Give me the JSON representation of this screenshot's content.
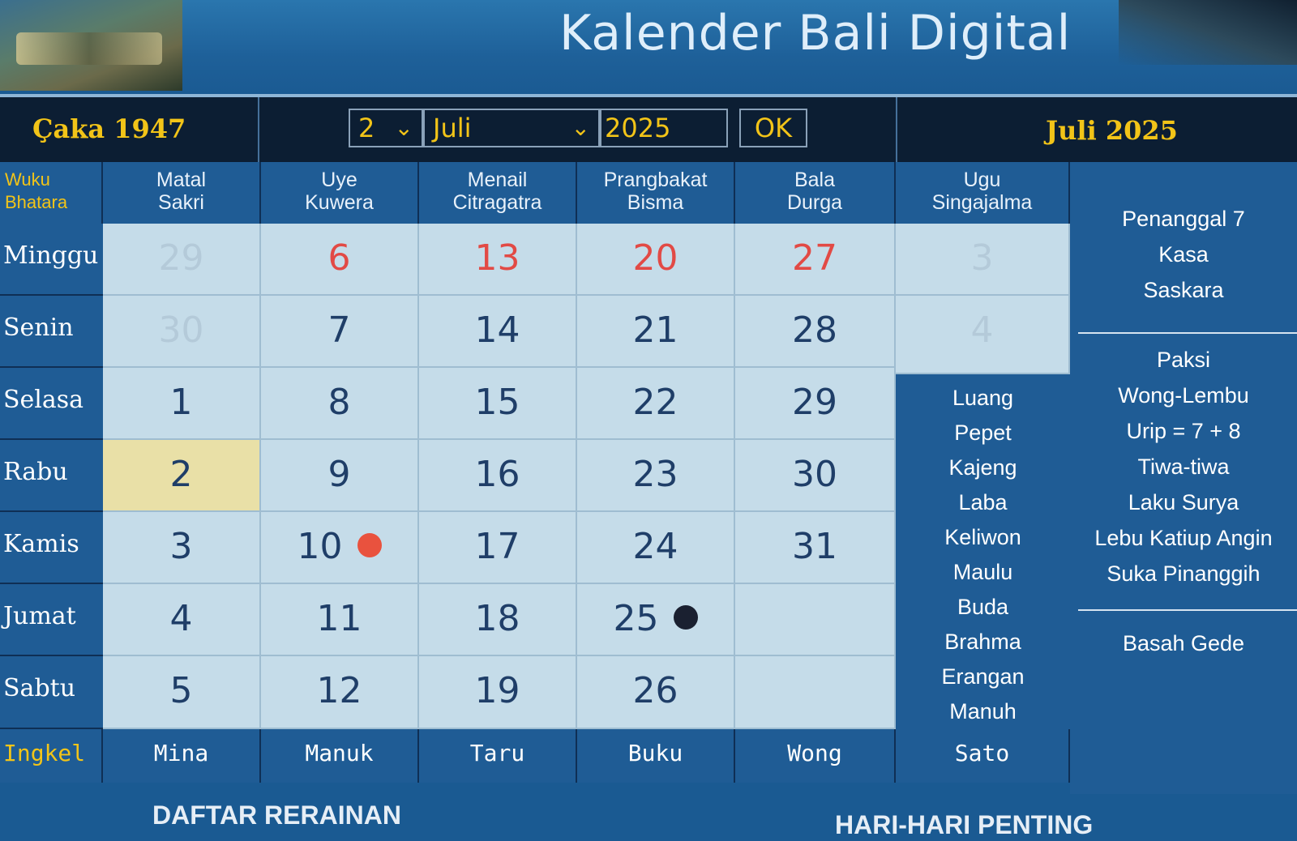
{
  "app": {
    "title": "Kalender Bali Digital"
  },
  "topbar": {
    "caka": "Çaka 1947",
    "day_select": "2",
    "month_select": "Juli",
    "year_input": "2025",
    "ok_label": "OK",
    "current_month": "Juli 2025"
  },
  "grid": {
    "corner_label": [
      "Wuku",
      "Bhatara"
    ],
    "columns": [
      {
        "line1": "Matal",
        "line2": "Sakri"
      },
      {
        "line1": "Uye",
        "line2": "Kuwera"
      },
      {
        "line1": "Menail",
        "line2": "Citragatra"
      },
      {
        "line1": "Prangbakat",
        "line2": "Bisma"
      },
      {
        "line1": "Bala",
        "line2": "Durga"
      },
      {
        "line1": "Ugu",
        "line2": "Singajalma"
      }
    ],
    "rows": [
      "Minggu",
      "Senin",
      "Selasa",
      "Rabu",
      "Kamis",
      "Jumat",
      "Sabtu"
    ],
    "cells": [
      [
        "29",
        "6",
        "13",
        "20",
        "27",
        "3"
      ],
      [
        "30",
        "7",
        "14",
        "21",
        "28",
        "4"
      ],
      [
        "1",
        "8",
        "15",
        "22",
        "29",
        ""
      ],
      [
        "2",
        "9",
        "16",
        "23",
        "30",
        ""
      ],
      [
        "3",
        "10",
        "17",
        "24",
        "31",
        ""
      ],
      [
        "4",
        "11",
        "18",
        "25",
        "",
        ""
      ],
      [
        "5",
        "12",
        "19",
        "26",
        "",
        ""
      ]
    ],
    "selected_day": "2",
    "full_moon_day": "10",
    "new_moon_day": "25",
    "info_column": [
      "Luang",
      "Pepet",
      "Kajeng",
      "Laba",
      "Keliwon",
      "Maulu",
      "Buda",
      "Brahma",
      "Erangan",
      "Manuh"
    ],
    "ingkel_label": "Ingkel",
    "ingkel": [
      "Mina",
      "Manuk",
      "Taru",
      "Buku",
      "Wong",
      "Sato"
    ]
  },
  "right_panel": {
    "group1": [
      "Penanggal 7",
      "Kasa",
      "Saskara"
    ],
    "group2": [
      "Paksi",
      "Wong-Lembu",
      "Urip = 7 + 8",
      "Tiwa-tiwa",
      "Laku Surya",
      "Lebu Katiup Angin",
      "Suka Pinanggih"
    ],
    "group3": [
      "Basah Gede"
    ]
  },
  "bottom": {
    "rerainan": "DAFTAR RERAINAN",
    "hari_penting": "HARI-HARI PENTING"
  },
  "colors": {
    "accent_yellow": "#f2c418",
    "panel_blue": "#1f5c95",
    "cell_bg": "#c5dce9",
    "sunday_red": "#e24a45",
    "today_bg": "#e9e0a7"
  }
}
